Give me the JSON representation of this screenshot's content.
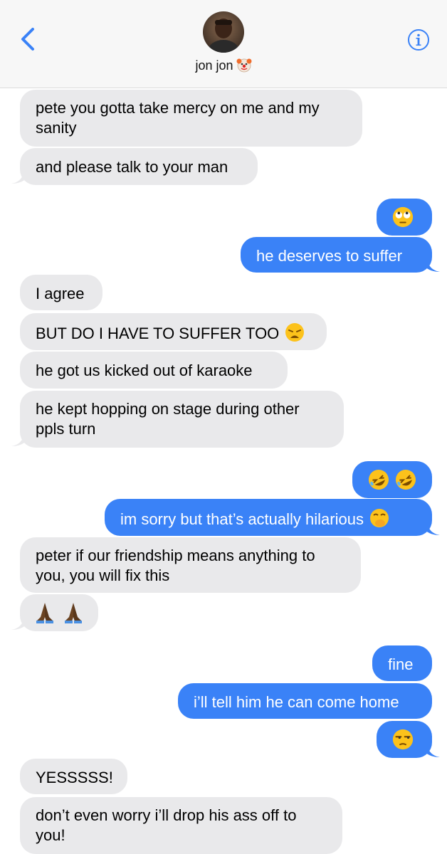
{
  "header": {
    "contact_name": "jon jon",
    "contact_emoji_icon": "clown-face-icon",
    "back_icon": "chevron-left-icon",
    "info_icon": "info-icon"
  },
  "colors": {
    "outgoing": "#3a82f7",
    "incoming": "#e9e9eb",
    "accent": "#3a82f7"
  },
  "messages": [
    {
      "from": "them",
      "text": "pete you gotta take mercy on me and my"
    },
    {
      "from": "them",
      "text": "sanity"
    },
    {
      "from": "them",
      "text": "and please talk to your man"
    },
    {
      "from": "me",
      "emoji": "face-with-rolling-eyes-icon"
    },
    {
      "from": "me",
      "text": "he deserves to suffer"
    },
    {
      "from": "them",
      "text": "I agree"
    },
    {
      "from": "them",
      "text": "BUT DO I HAVE TO SUFFER TOO",
      "emoji": "weary-face-icon"
    },
    {
      "from": "them",
      "text": "he got us kicked out of karaoke"
    },
    {
      "from": "them",
      "text": "he kept hopping on stage during other"
    },
    {
      "from": "them",
      "text": "ppls turn"
    },
    {
      "from": "me",
      "emoji": "rolling-on-floor-laughing-icon x2"
    },
    {
      "from": "me",
      "text": "im sorry but that’s actually hilarious",
      "emoji": "face-with-hand-over-mouth-icon"
    },
    {
      "from": "them",
      "text": "peter if our friendship means anything to"
    },
    {
      "from": "them",
      "text": "you, you will fix this"
    },
    {
      "from": "them",
      "emoji": "folded-hands-icon x2"
    },
    {
      "from": "me",
      "text": "fine"
    },
    {
      "from": "me",
      "text": "i’ll tell him he can come home"
    },
    {
      "from": "me",
      "emoji": "unamused-face-icon"
    },
    {
      "from": "them",
      "text": "YESSSSS!"
    },
    {
      "from": "them",
      "text": "don’t even worry i’ll drop his ass off to"
    },
    {
      "from": "them",
      "text": "you!"
    }
  ]
}
